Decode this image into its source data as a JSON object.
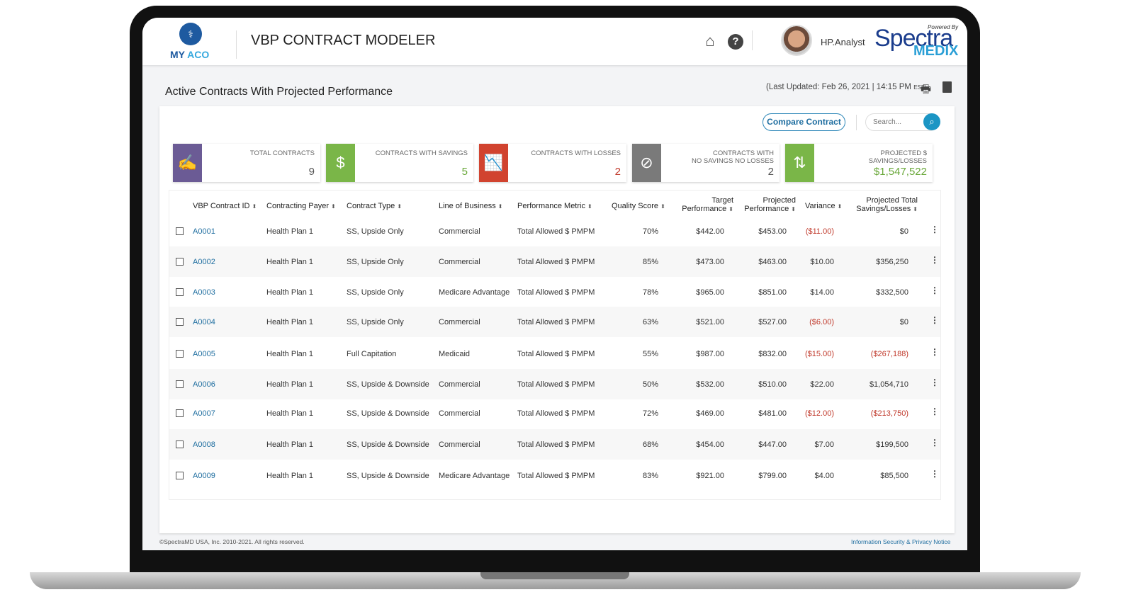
{
  "header": {
    "logo": "MY ACO",
    "title": "VBP CONTRACT MODELER",
    "user": "HP.Analyst",
    "brand_powered": "Powered By",
    "brand_name": "Spectra",
    "brand_sub": "MEDIX",
    "icons": [
      "home-icon",
      "help-icon"
    ]
  },
  "page": {
    "title": "Active Contracts With Projected Performance",
    "last_updated": "(Last Updated: Feb 26, 2021  | 14:15 PM",
    "tz": "EST)",
    "icons": [
      "print-icon",
      "export-icon"
    ]
  },
  "toolbar": {
    "compare": "Compare Contract",
    "search_placeholder": "Search..."
  },
  "kpis": [
    {
      "label1": "TOTAL CONTRACTS",
      "label2": "",
      "value": "9",
      "color": "#6b5b95",
      "value_color": "#555"
    },
    {
      "label1": "CONTRACTS WITH SAVINGS",
      "label2": "",
      "value": "5",
      "color": "#7ab648",
      "value_color": "#6aa83a"
    },
    {
      "label1": "CONTRACTS WITH LOSSES",
      "label2": "",
      "value": "2",
      "color": "#d1432f",
      "value_color": "#c0392b"
    },
    {
      "label1": "CONTRACTS WITH",
      "label2": "NO SAVINGS NO LOSSES",
      "value": "2",
      "color": "#7a7a7a",
      "value_color": "#555"
    },
    {
      "label1": "PROJECTED $",
      "label2": "SAVINGS/LOSSES",
      "value": "$1,547,522",
      "color": "#7ab648",
      "value_color": "#6aa83a"
    }
  ],
  "table": {
    "headers": [
      "VBP Contract ID",
      "Contracting Payer",
      "Contract Type",
      "Line of Business",
      "Performance Metric",
      "Quality Score",
      "Target",
      "Performance",
      "Projected",
      "Performance",
      "Variance",
      "Projected Total",
      "Savings/Losses"
    ],
    "rows": [
      [
        "A0001",
        "Health Plan 1",
        "SS, Upside Only",
        "Commercial",
        "Total Allowed $ PMPM",
        "70%",
        "$442.00",
        "$453.00",
        "($11.00)",
        "$0"
      ],
      [
        "A0002",
        "Health Plan 1",
        "SS, Upside Only",
        "Commercial",
        "Total Allowed $ PMPM",
        "85%",
        "$473.00",
        "$463.00",
        "$10.00",
        "$356,250"
      ],
      [
        "A0003",
        "Health Plan 1",
        "SS, Upside Only",
        "Medicare Advantage",
        "Total Allowed $ PMPM",
        "78%",
        "$965.00",
        "$851.00",
        "$14.00",
        "$332,500"
      ],
      [
        "A0004",
        "Health Plan 1",
        "SS, Upside Only",
        "Commercial",
        "Total Allowed $ PMPM",
        "63%",
        "$521.00",
        "$527.00",
        "($6.00)",
        "$0"
      ],
      [
        "A0005",
        "Health Plan 1",
        "Full Capitation",
        "Medicaid",
        "Total Allowed $ PMPM",
        "55%",
        "$987.00",
        "$832.00",
        "($15.00)",
        "($267,188)"
      ],
      [
        "A0006",
        "Health Plan 1",
        "SS, Upside & Downside",
        "Commercial",
        "Total Allowed $ PMPM",
        "50%",
        "$532.00",
        "$510.00",
        "$22.00",
        "$1,054,710"
      ],
      [
        "A0007",
        "Health Plan 1",
        "SS, Upside & Downside",
        "Commercial",
        "Total Allowed $ PMPM",
        "72%",
        "$469.00",
        "$481.00",
        "($12.00)",
        "($213,750)"
      ],
      [
        "A0008",
        "Health Plan 1",
        "SS, Upside & Downside",
        "Commercial",
        "Total Allowed $ PMPM",
        "68%",
        "$454.00",
        "$447.00",
        "$7.00",
        "$199,500"
      ],
      [
        "A0009",
        "Health Plan 1",
        "SS, Upside & Downside",
        "Medicare Advantage",
        "Total Allowed $ PMPM",
        "83%",
        "$921.00",
        "$799.00",
        "$4.00",
        "$85,500"
      ]
    ]
  },
  "footer": {
    "copyright": "©SpectraMD USA, Inc. 2010-2021. All rights reserved.",
    "privacy": "Information Security & Privacy Notice"
  }
}
